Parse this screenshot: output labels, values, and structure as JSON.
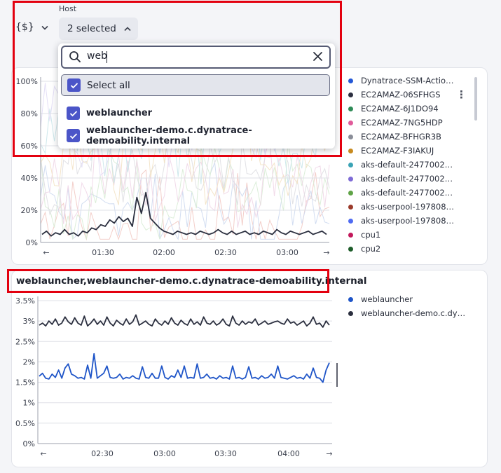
{
  "variable": {
    "label": "{$}"
  },
  "host": {
    "label": "Host",
    "selected_text": "2 selected",
    "search_value": "web",
    "options": [
      {
        "label": "Select all",
        "checked": true
      },
      {
        "label": "weblauncher",
        "checked": true
      },
      {
        "label": "weblauncher-demo.c.dynatrace-demoability.internal",
        "checked": true
      }
    ]
  },
  "legend_top": [
    {
      "label": "Dynatrace-SSM-Actio…",
      "color": "#2458d6"
    },
    {
      "label": "EC2AMAZ-06SFHGS",
      "color": "#2b2f3f"
    },
    {
      "label": "EC2AMAZ-6J1DO94",
      "color": "#2e8b57"
    },
    {
      "label": "EC2AMAZ-7NG5HDP",
      "color": "#e05b9a"
    },
    {
      "label": "EC2AMAZ-BFHGR3B",
      "color": "#8a8d98"
    },
    {
      "label": "EC2AMAZ-F3IAKUJ",
      "color": "#c78a1f"
    },
    {
      "label": "aks-default-2477002…",
      "color": "#3aa3b5"
    },
    {
      "label": "aks-default-2477002…",
      "color": "#7e6bd6"
    },
    {
      "label": "aks-default-2477002…",
      "color": "#5fa346"
    },
    {
      "label": "aks-userpool-197808…",
      "color": "#9a3a2a"
    },
    {
      "label": "aks-userpool-197808…",
      "color": "#4f6bf2"
    },
    {
      "label": "cpu1",
      "color": "#c2185b"
    },
    {
      "label": "cpu2",
      "color": "#1e5d2a"
    }
  ],
  "section2": {
    "title": "weblauncher,weblauncher-demo.c.dynatrace-demoability.internal"
  },
  "legend_bottom": [
    {
      "label": "weblauncher",
      "color": "#1f55c8"
    },
    {
      "label": "weblauncher-demo.c.dy…",
      "color": "#2b2f3f"
    }
  ],
  "chart_data": [
    {
      "type": "line",
      "ylim": [
        0,
        100
      ],
      "yticks": [
        "0%",
        "20%",
        "40%",
        "60%",
        "80%",
        "100%"
      ],
      "xticks": [
        "01:30",
        "02:00",
        "02:30",
        "03:00"
      ],
      "series": [
        {
          "name": "EC2AMAZ-06SFHGS",
          "color": "#2b2f3f",
          "values": [
            5,
            7,
            4,
            6,
            5,
            8,
            5,
            6,
            4,
            7,
            6,
            9,
            8,
            11,
            10,
            14,
            12,
            16,
            13,
            15,
            10,
            28,
            18,
            31,
            15,
            12,
            9,
            7,
            6,
            5,
            7,
            6,
            5,
            6,
            5,
            7,
            6,
            5,
            6,
            8,
            6,
            5,
            7,
            5,
            6,
            7,
            5,
            6,
            5,
            7,
            6,
            5,
            8,
            6,
            5,
            7,
            6,
            5,
            6,
            7,
            5,
            6,
            7,
            5
          ]
        }
      ]
    },
    {
      "type": "line",
      "ylim": [
        0,
        3.5
      ],
      "yticks": [
        "0%",
        "0.5%",
        "1%",
        "1.5%",
        "2%",
        "2.5%",
        "3%",
        "3.5%"
      ],
      "xticks": [
        "02:30",
        "03:00",
        "03:30",
        "04:00"
      ],
      "series": [
        {
          "name": "weblauncher",
          "color": "#1f55c8",
          "values": [
            1.65,
            1.72,
            1.6,
            1.58,
            1.7,
            1.62,
            1.8,
            1.6,
            1.85,
            1.95,
            1.7,
            1.66,
            1.6,
            1.62,
            1.58,
            1.92,
            1.6,
            2.2,
            1.6,
            1.66,
            1.72,
            1.9,
            1.62,
            1.6,
            1.62,
            1.7,
            1.58,
            1.62,
            1.6,
            1.66,
            1.6,
            1.58,
            1.88,
            1.62,
            1.6,
            1.72,
            1.6,
            1.6,
            1.9,
            1.62,
            1.58,
            1.66,
            1.62,
            1.8,
            1.62,
            1.9,
            1.6,
            1.62,
            1.6,
            1.95,
            1.6,
            1.62,
            1.7,
            1.6,
            1.62,
            1.58,
            1.66,
            1.6,
            1.62,
            1.58,
            1.9,
            1.6,
            1.62,
            1.58,
            1.62,
            1.88,
            1.6,
            1.62,
            1.58,
            1.66,
            1.6,
            1.62,
            1.7,
            1.6,
            1.9,
            1.62,
            1.6,
            1.58,
            1.62,
            1.66,
            1.6,
            1.62,
            1.58,
            1.7,
            1.6,
            1.85,
            1.62,
            1.6,
            1.5,
            1.8,
            1.98
          ]
        },
        {
          "name": "weblauncher-demo.c.dynatrace-demoability.internal",
          "color": "#2b2f3f",
          "values": [
            2.9,
            2.95,
            2.88,
            3.0,
            2.92,
            3.05,
            2.9,
            2.95,
            3.1,
            2.98,
            2.92,
            3.08,
            2.95,
            2.9,
            3.12,
            2.88,
            2.95,
            3.05,
            2.92,
            3.0,
            2.9,
            3.1,
            2.95,
            2.88,
            3.02,
            2.95,
            2.9,
            3.05,
            2.92,
            2.98,
            3.15,
            2.9,
            2.95,
            3.0,
            2.92,
            2.88,
            3.05,
            2.95,
            2.9,
            3.0,
            2.92,
            3.08,
            2.95,
            2.9,
            3.02,
            2.94,
            2.9,
            3.05,
            2.92,
            2.98,
            2.9,
            3.1,
            2.95,
            2.92,
            3.0,
            2.9,
            2.95,
            3.05,
            2.92,
            2.88,
            3.12,
            2.95,
            2.9,
            3.0,
            2.92,
            2.98,
            2.95,
            3.05,
            2.9,
            2.95,
            3.0,
            2.92,
            2.95,
            2.98,
            3.0,
            2.95,
            2.92,
            3.05,
            2.95,
            2.98,
            2.9,
            2.95,
            3.0,
            2.88,
            2.95,
            3.1,
            2.92,
            2.95,
            2.85,
            3.0,
            2.9
          ]
        }
      ]
    }
  ]
}
